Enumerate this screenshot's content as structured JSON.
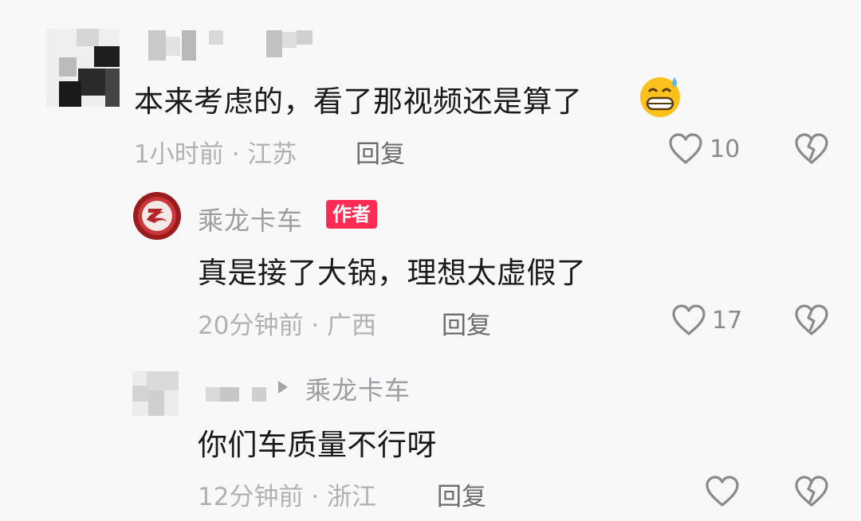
{
  "comments": [
    {
      "text": "本来考虑的，看了那视频还是算了",
      "emoji": "😅",
      "meta": "1小时前 · 江苏",
      "reply_label": "回复",
      "likes": "10"
    },
    {
      "username": "乘龙卡车",
      "badge": "作者",
      "text": "真是接了大锅，理想太虚假了",
      "meta": "20分钟前 · 广西",
      "reply_label": "回复",
      "likes": "17"
    },
    {
      "reply_to": "乘龙卡车",
      "text": "你们车质量不行呀",
      "meta": "12分钟前 · 浙江",
      "reply_label": "回复",
      "likes": ""
    }
  ],
  "colors": {
    "badge": "#fe2c55",
    "meta": "#b1b1b4",
    "text": "#1a1a1a"
  }
}
